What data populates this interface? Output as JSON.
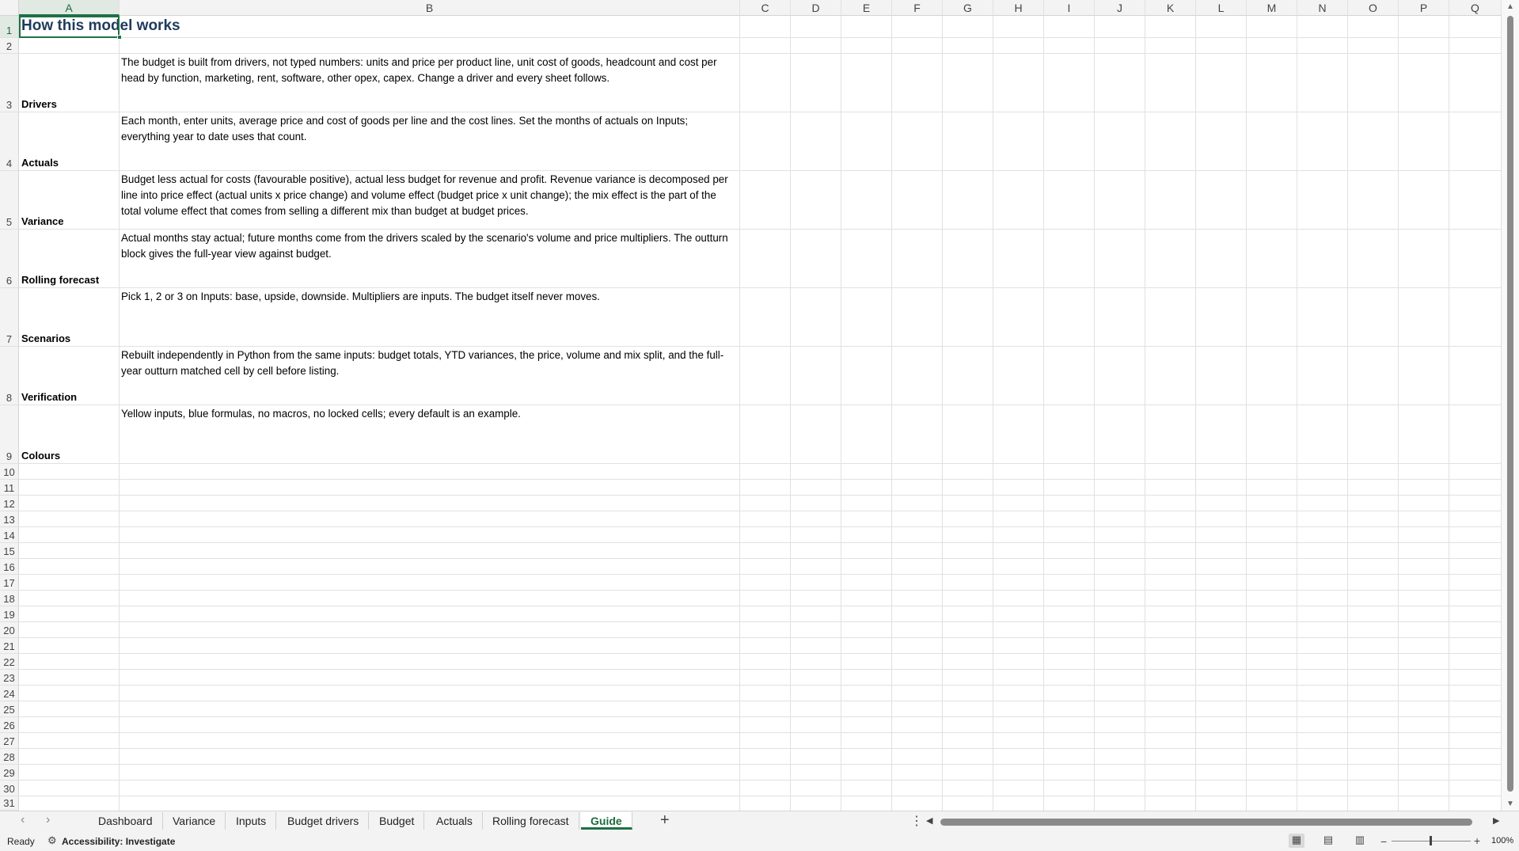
{
  "columns": [
    "A",
    "B",
    "C",
    "D",
    "E",
    "F",
    "G",
    "H",
    "I",
    "J",
    "K",
    "L",
    "M",
    "N",
    "O",
    "P",
    "Q"
  ],
  "rows": [
    "1",
    "2",
    "3",
    "4",
    "5",
    "6",
    "7",
    "8",
    "9",
    "10",
    "11",
    "12",
    "13",
    "14",
    "15",
    "16",
    "17",
    "18",
    "19",
    "20",
    "21",
    "22",
    "23",
    "24",
    "25",
    "26",
    "27",
    "28",
    "29",
    "30",
    "31"
  ],
  "sheet": {
    "title": "How this model works",
    "sections": [
      {
        "label": "Drivers",
        "text": "The budget is built from drivers, not typed numbers: units and price per product line, unit cost of goods, headcount and cost per head by function, marketing, rent, software, other opex, capex. Change a driver and every sheet follows."
      },
      {
        "label": "Actuals",
        "text": "Each month, enter units, average price and cost of goods per line and the cost lines. Set the months of actuals on Inputs; everything year to date uses that count."
      },
      {
        "label": "Variance",
        "text": "Budget less actual for costs (favourable positive), actual less budget for revenue and profit. Revenue variance is decomposed per line into price effect (actual units x price change) and volume effect (budget price x unit change); the mix effect is the part of the total volume effect that comes from selling a different mix than budget at budget prices."
      },
      {
        "label": "Rolling forecast",
        "text": "Actual months stay actual; future months come from the drivers scaled by the scenario's volume and price multipliers. The outturn block gives the full-year view against budget."
      },
      {
        "label": "Scenarios",
        "text": "Pick 1, 2 or 3 on Inputs: base, upside, downside. Multipliers are inputs. The budget itself never moves."
      },
      {
        "label": "Verification",
        "text": "Rebuilt independently in Python from the same inputs: budget totals, YTD variances, the price, volume and mix split, and the full-year outturn matched cell by cell before listing."
      },
      {
        "label": "Colours",
        "text": "Yellow inputs, blue formulas, no macros, no locked cells; every default is an example."
      }
    ]
  },
  "tabs": [
    {
      "label": "Dashboard"
    },
    {
      "label": "Variance"
    },
    {
      "label": "Inputs"
    },
    {
      "label": "Budget drivers"
    },
    {
      "label": "Budget"
    },
    {
      "label": "Actuals"
    },
    {
      "label": "Rolling forecast"
    },
    {
      "label": "Guide",
      "active": true
    }
  ],
  "add_tab_icon": "plus-icon",
  "status": {
    "ready": "Ready",
    "accessibility": "Accessibility: Investigate",
    "zoom": "100%"
  },
  "colors": {
    "accent": "#1e7145",
    "title": "#1f3b5c",
    "header_bg": "#f3f3f3",
    "gridline": "#e1e1e1"
  }
}
